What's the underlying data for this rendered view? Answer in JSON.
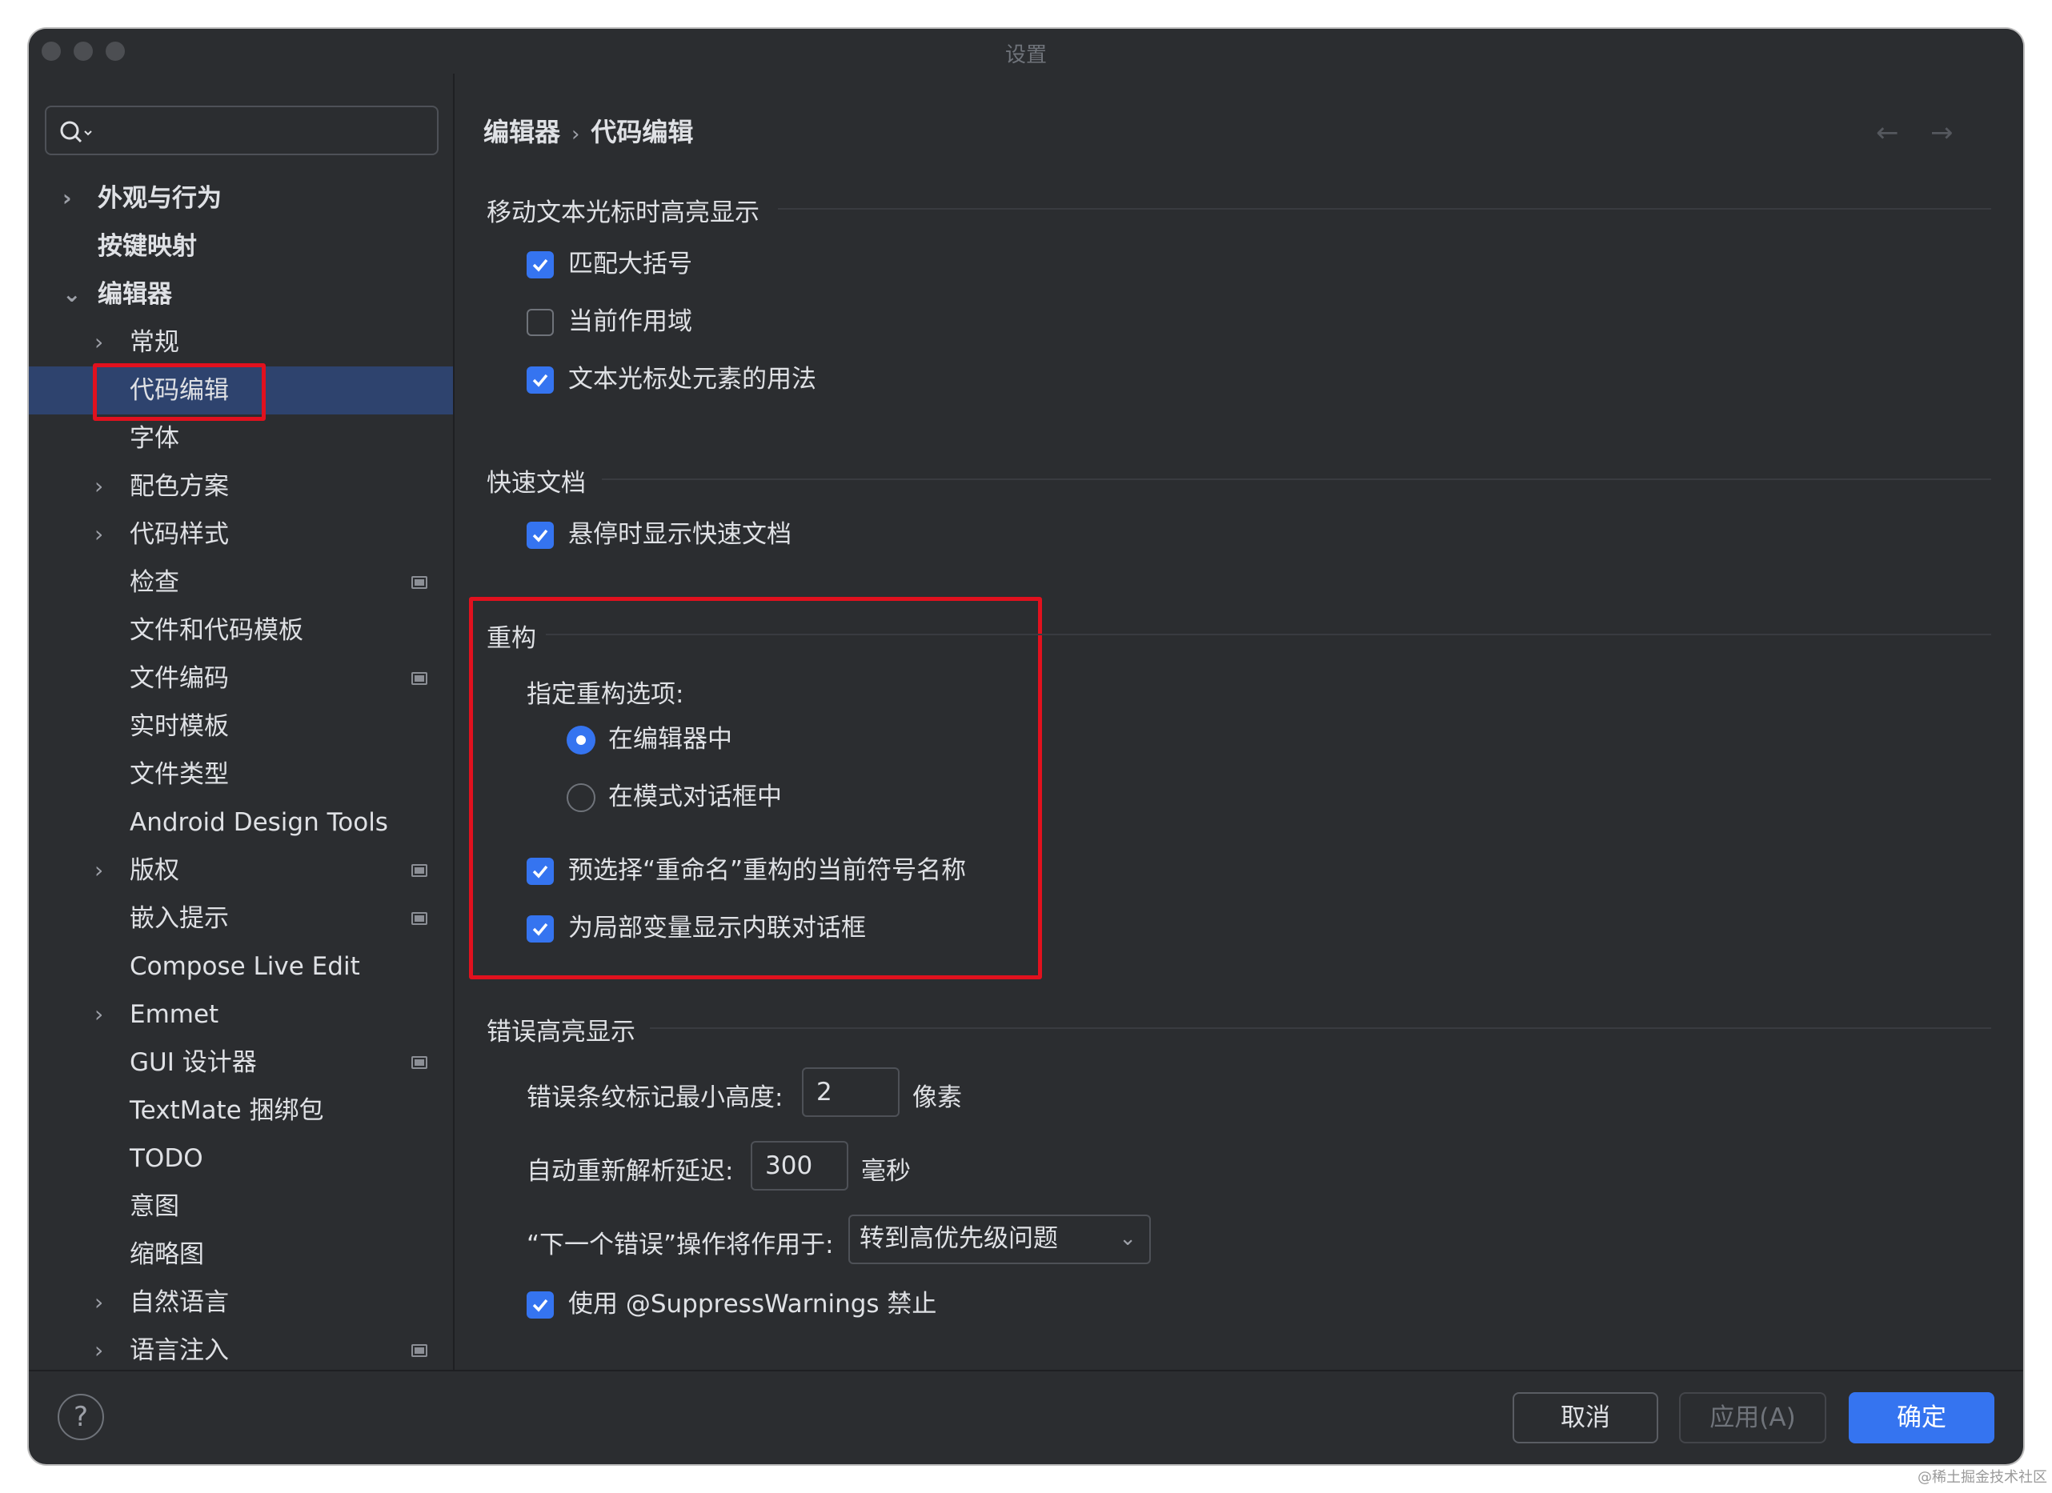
{
  "window": {
    "title": "设置"
  },
  "search": {
    "value": "",
    "placeholder": ""
  },
  "sidebar": {
    "items": [
      {
        "label": "外观与行为",
        "expandable": true,
        "expanded": false
      },
      {
        "label": "按键映射",
        "expandable": false
      },
      {
        "label": "编辑器",
        "expandable": true,
        "expanded": true
      },
      {
        "label": "常规",
        "expandable": true,
        "expanded": false
      },
      {
        "label": "代码编辑",
        "selected": true
      },
      {
        "label": "字体"
      },
      {
        "label": "配色方案",
        "expandable": true
      },
      {
        "label": "代码样式",
        "expandable": true
      },
      {
        "label": "检查",
        "badge": true
      },
      {
        "label": "文件和代码模板"
      },
      {
        "label": "文件编码",
        "badge": true
      },
      {
        "label": "实时模板"
      },
      {
        "label": "文件类型"
      },
      {
        "label": "Android Design Tools"
      },
      {
        "label": "版权",
        "expandable": true,
        "badge": true
      },
      {
        "label": "嵌入提示",
        "badge": true
      },
      {
        "label": "Compose Live Edit"
      },
      {
        "label": "Emmet",
        "expandable": true
      },
      {
        "label": "GUI 设计器",
        "badge": true
      },
      {
        "label": "TextMate 捆绑包"
      },
      {
        "label": "TODO"
      },
      {
        "label": "意图"
      },
      {
        "label": "缩略图"
      },
      {
        "label": "自然语言",
        "expandable": true
      },
      {
        "label": "语言注入",
        "expandable": true,
        "badge": true
      }
    ]
  },
  "breadcrumb": {
    "parent": "编辑器",
    "separator": "›",
    "current": "代码编辑"
  },
  "sections": {
    "highlight": {
      "title": "移动文本光标时高亮显示",
      "options": [
        {
          "label": "匹配大括号",
          "checked": true
        },
        {
          "label": "当前作用域",
          "checked": false
        },
        {
          "label": "文本光标处元素的用法",
          "checked": true
        }
      ]
    },
    "quick_doc": {
      "title": "快速文档",
      "options": [
        {
          "label": "悬停时显示快速文档",
          "checked": true
        }
      ]
    },
    "refactor": {
      "title": "重构",
      "subtitle": "指定重构选项:",
      "radios": [
        {
          "label": "在编辑器中",
          "selected": true
        },
        {
          "label": "在模式对话框中",
          "selected": false
        }
      ],
      "options": [
        {
          "label": "预选择“重命名”重构的当前符号名称",
          "checked": true
        },
        {
          "label": "为局部变量显示内联对话框",
          "checked": true
        }
      ]
    },
    "error": {
      "title": "错误高亮显示",
      "min_height_label": "错误条纹标记最小高度:",
      "min_height_value": "2",
      "min_height_unit": "像素",
      "reparse_label": "自动重新解析延迟:",
      "reparse_value": "300",
      "reparse_unit": "毫秒",
      "next_error_label": "“下一个错误”操作将作用于:",
      "next_error_value": "转到高优先级问题",
      "suppress": {
        "label": "使用 @SuppressWarnings 禁止",
        "checked": true
      }
    }
  },
  "footer": {
    "help": "?",
    "cancel": "取消",
    "apply": "应用(A)",
    "ok": "确定"
  },
  "watermark": "@稀土掘金技术社区",
  "colors": {
    "accent": "#3574f0",
    "background": "#2b2d30",
    "selection": "#2e436e",
    "highlight_box": "#e1111e"
  }
}
